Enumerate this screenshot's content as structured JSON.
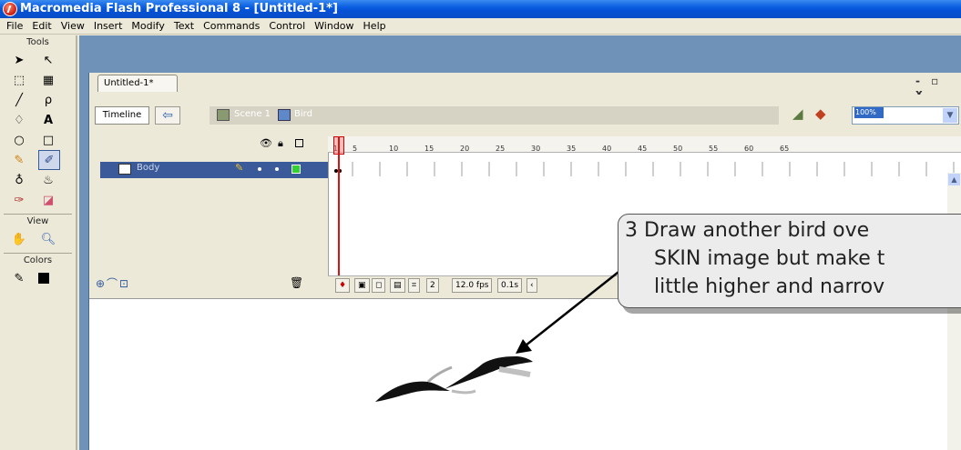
{
  "window": {
    "title": "Macromedia Flash Professional 8 - [Untitled-1*]"
  },
  "menu": [
    "File",
    "Edit",
    "View",
    "Insert",
    "Modify",
    "Text",
    "Commands",
    "Control",
    "Window",
    "Help"
  ],
  "tools_panel": {
    "title": "Tools",
    "tools": [
      "arrow-tool",
      "subselect-tool",
      "free-transform-tool",
      "fill-transform-tool",
      "line-tool",
      "lasso-tool",
      "pen-tool",
      "text-tool",
      "oval-tool",
      "rectangle-tool",
      "pencil-tool",
      "brush-tool",
      "ink-bottle-tool",
      "paint-bucket-tool",
      "eyedropper-tool",
      "eraser-tool"
    ],
    "view_label": "View",
    "colors_label": "Colors"
  },
  "document": {
    "tab": "Untitled-1*",
    "window_controls": "- ▫ x"
  },
  "edit_bar": {
    "timeline_button": "Timeline",
    "scene": "Scene 1",
    "symbol": "Bird",
    "zoom": "100%"
  },
  "timeline": {
    "ruler_ticks": [
      "1",
      "5",
      "10",
      "15",
      "20",
      "25",
      "30",
      "35",
      "40",
      "45",
      "50",
      "55",
      "60",
      "65"
    ],
    "layer_name": "Body",
    "current_frame": "2",
    "frame_rate": "12.0 fps",
    "elapsed": "0.1s"
  },
  "callout": {
    "lines": [
      "3  Draw another bird ove",
      "SKIN image but make t",
      "little higher and narrov"
    ]
  },
  "colors": {
    "title_bar": "#0a5de0",
    "doc_bg": "#6f93b8",
    "layer_selected": "#3a5a9a",
    "playhead": "#e01010"
  }
}
